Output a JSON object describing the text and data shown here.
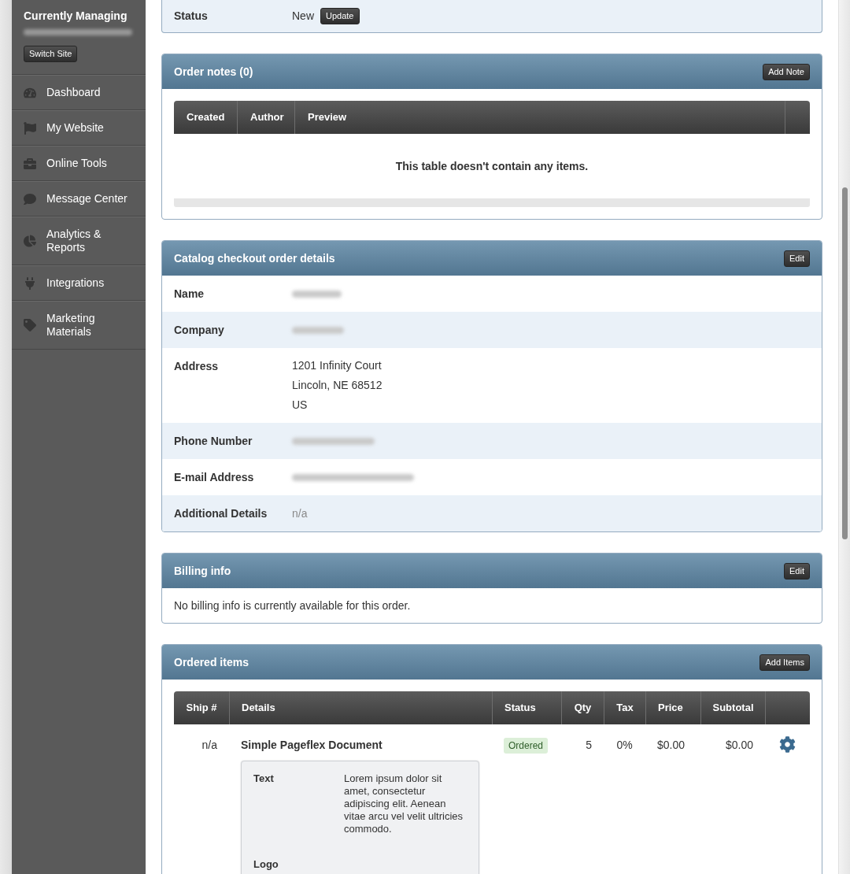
{
  "sidebar": {
    "heading": "Currently Managing",
    "switch_button": "Switch Site",
    "items": [
      {
        "label": "Dashboard",
        "selected": false
      },
      {
        "label": "My Website",
        "selected": false
      },
      {
        "label": "Online Tools",
        "selected": false
      },
      {
        "label": "Message Center",
        "selected": false
      },
      {
        "label": "Analytics & Reports",
        "selected": false
      },
      {
        "label": "Integrations",
        "selected": false
      },
      {
        "label": "Marketing Materials",
        "selected": false
      }
    ]
  },
  "status": {
    "label": "Status",
    "value": "New",
    "button": "Update"
  },
  "order_notes": {
    "title": "Order notes (0)",
    "button": "Add Note",
    "columns": [
      "Created",
      "Author",
      "Preview"
    ],
    "empty_message": "This table doesn't contain any items."
  },
  "order_details": {
    "title": "Catalog checkout order details",
    "button": "Edit",
    "rows": [
      {
        "label": "Name",
        "kind": "blurred"
      },
      {
        "label": "Company",
        "kind": "blurred"
      },
      {
        "label": "Address",
        "kind": "lines",
        "lines": [
          "1201 Infinity Court",
          "Lincoln, NE 68512",
          "US"
        ]
      },
      {
        "label": "Phone Number",
        "kind": "blurred"
      },
      {
        "label": "E-mail Address",
        "kind": "blurred"
      },
      {
        "label": "Additional Details",
        "kind": "muted",
        "value": "n/a"
      }
    ]
  },
  "billing": {
    "title": "Billing info",
    "button": "Edit",
    "message": "No billing info is currently available for this order."
  },
  "ordered_items": {
    "title": "Ordered items",
    "button": "Add Items",
    "columns": [
      "Ship #",
      "Details",
      "Status",
      "Qty",
      "Tax",
      "Price",
      "Subtotal"
    ],
    "rows": [
      {
        "ship": "n/a",
        "name": "Simple Pageflex Document",
        "status": "Ordered",
        "qty": "5",
        "tax": "0%",
        "price": "$0.00",
        "subtotal": "$0.00",
        "fields": [
          {
            "label": "Text",
            "value": "Lorem ipsum dolor sit amet, consectetur adipiscing elit. Aenean vitae arcu vel velit ultricies commodo."
          },
          {
            "label": "Logo"
          }
        ]
      }
    ]
  }
}
